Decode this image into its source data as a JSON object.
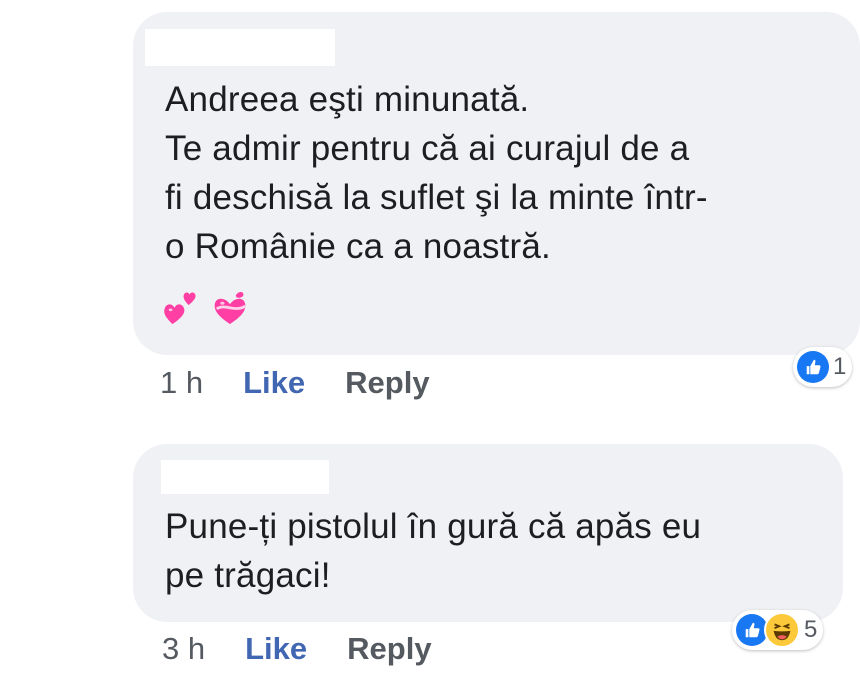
{
  "comments": [
    {
      "text": "Andreea eşti minunată.\nTe admir pentru că ai curajul de a\nfi deschisă la suflet şi la minte într-\no Românie ca a noastră.",
      "emoji": [
        "two-hearts-icon",
        "heart-with-ribbon-icon"
      ],
      "time": "1 h",
      "like_label": "Like",
      "reply_label": "Reply",
      "reactions": [
        "like"
      ],
      "reaction_count": "1"
    },
    {
      "text": "Pune-ți pistolul în gură că apăs eu\npe trăgaci!",
      "time": "3 h",
      "like_label": "Like",
      "reply_label": "Reply",
      "reactions": [
        "like",
        "haha"
      ],
      "reaction_count": "5"
    }
  ],
  "colors": {
    "bubble": "#f0f1f4",
    "like_blue": "#4267b2",
    "meta_gray": "#555a61",
    "heart_pink": "#ff3fa4"
  }
}
